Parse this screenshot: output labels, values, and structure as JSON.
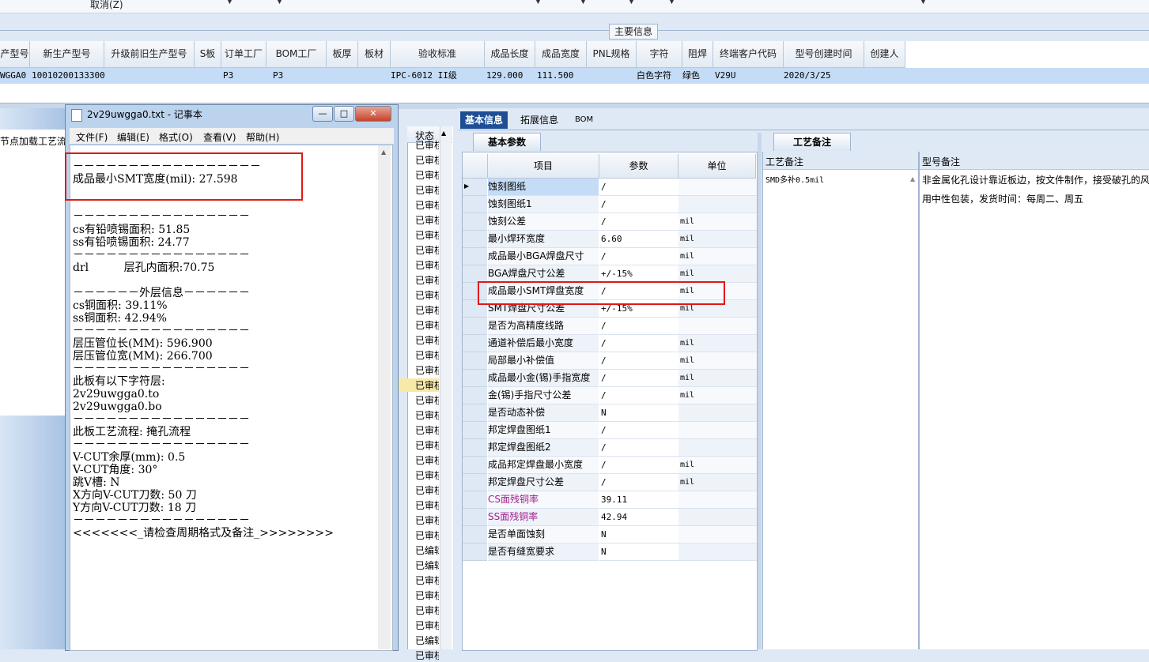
{
  "toolbar": {
    "cancel_label": "取消(Z)"
  },
  "main_info_label": "主要信息",
  "grid": {
    "headers": [
      "产型号",
      "新生产型号",
      "升级前旧生产型号",
      "S板",
      "订单工厂",
      "BOM工厂",
      "板厚",
      "板材",
      "验收标准",
      "成品长度",
      "成品宽度",
      "PNL规格",
      "字符",
      "阻焊",
      "终端客户代码",
      "型号创建时间",
      "创建人"
    ],
    "row": [
      "WGGA0",
      "10010200133300",
      "",
      "",
      "P3",
      "P3",
      "",
      "",
      "IPC-6012 II级",
      "129.000",
      "111.500",
      "",
      "白色字符",
      "绿色",
      "V29U",
      "2020/3/25",
      ""
    ]
  },
  "left_label": "节点加载工艺流",
  "notepad": {
    "title": "2v29uwgga0.txt - 记事本",
    "menu": [
      "文件(F)",
      "编辑(E)",
      "格式(O)",
      "查看(V)",
      "帮助(H)"
    ],
    "buttons": {
      "min": "—",
      "max": "□",
      "close": "✕"
    },
    "lines": [
      "－－－－－－－－－－－－－－－－－",
      "成品最小SMT宽度(mil): 27.598",
      "－－－－－－－－－－－－－－－－",
      "cs有铅喷锡面积: 51.85",
      "ss有铅喷锡面积: 24.77",
      "－－－－－－－－－－－－－－－－",
      "drl          层孔内面积:70.75",
      "－－－－－－外层信息－－－－－－",
      "cs铜面积: 39.11%",
      "ss铜面积: 42.94%",
      "－－－－－－－－－－－－－－－－",
      "层压管位长(MM): 596.900",
      "层压管位宽(MM): 266.700",
      "－－－－－－－－－－－－－－－－",
      "此板有以下字符层:",
      "2v29uwgga0.to",
      "2v29uwgga0.bo",
      "－－－－－－－－－－－－－－－－",
      "此板工艺流程: 掩孔流程",
      "－－－－－－－－－－－－－－－－",
      "V-CUT余厚(mm): 0.5",
      "V-CUT角度: 30°",
      "跳V槽: N",
      "X方向V-CUT刀数: 50 刀",
      "Y方向V-CUT刀数: 18 刀",
      "－－－－－－－－－－－－－－－－",
      "<<<<<<<_请检查周期格式及备注_>>>>>>>>"
    ]
  },
  "status": {
    "header": "状态",
    "items": [
      "已审核",
      "已审核",
      "已审核",
      "已审核",
      "已审核",
      "已审核",
      "已审核",
      "已审核",
      "已审核",
      "已审核",
      "已审核",
      "已审核",
      "已审核",
      "已审核",
      "已审核",
      "已审核",
      "已审核",
      "已审核",
      "已审核",
      "已审核",
      "已审核",
      "已审核",
      "已审核",
      "已审核",
      "已审核",
      "已审核",
      "已审核",
      "已编辑",
      "已编辑",
      "已审核",
      "已审核",
      "已审核",
      "已审核",
      "已编辑",
      "已审核"
    ]
  },
  "tabs": [
    "基本信息",
    "拓展信息",
    "BOM"
  ],
  "basic_params": {
    "subtab": "基本参数",
    "headers": [
      "项目",
      "参数",
      "单位"
    ],
    "rows": [
      {
        "item": "蚀刻图纸",
        "param": "/",
        "unit": ""
      },
      {
        "item": "蚀刻图纸1",
        "param": "/",
        "unit": ""
      },
      {
        "item": "蚀刻公差",
        "param": "/",
        "unit": "mil"
      },
      {
        "item": "最小焊环宽度",
        "param": "6.60",
        "unit": "mil"
      },
      {
        "item": "成品最小BGA焊盘尺寸",
        "param": "/",
        "unit": "mil"
      },
      {
        "item": "BGA焊盘尺寸公差",
        "param": "+/-15%",
        "unit": "mil"
      },
      {
        "item": "成品最小SMT焊盘宽度",
        "param": "/",
        "unit": "mil"
      },
      {
        "item": "SMT焊盘尺寸公差",
        "param": "+/-15%",
        "unit": "mil"
      },
      {
        "item": "是否为高精度线路",
        "param": "/",
        "unit": ""
      },
      {
        "item": "通道补偿后最小宽度",
        "param": "/",
        "unit": "mil"
      },
      {
        "item": "局部最小补偿值",
        "param": "/",
        "unit": "mil"
      },
      {
        "item": "成品最小金(锡)手指宽度",
        "param": "/",
        "unit": "mil"
      },
      {
        "item": "金(锡)手指尺寸公差",
        "param": "/",
        "unit": "mil"
      },
      {
        "item": "是否动态补偿",
        "param": "N",
        "unit": ""
      },
      {
        "item": "邦定焊盘图纸1",
        "param": "/",
        "unit": ""
      },
      {
        "item": "邦定焊盘图纸2",
        "param": "/",
        "unit": ""
      },
      {
        "item": "成品邦定焊盘最小宽度",
        "param": "/",
        "unit": "mil"
      },
      {
        "item": "邦定焊盘尺寸公差",
        "param": "/",
        "unit": "mil"
      },
      {
        "item": "CS面残铜率",
        "param": "39.11",
        "unit": ""
      },
      {
        "item": "SS面残铜率",
        "param": "42.94",
        "unit": ""
      },
      {
        "item": "是否单面蚀刻",
        "param": "N",
        "unit": ""
      },
      {
        "item": "是否有缝宽要求",
        "param": "N",
        "unit": ""
      }
    ],
    "highlight_color": "#a0208a"
  },
  "craft_notes": {
    "tab": "工艺备注",
    "col1_header": "工艺备注",
    "col2_header": "型号备注",
    "col1_text": "SMD多补0.5mil",
    "col2_line1": "非金属化孔设计靠近板边，按文件制作，接受破孔的风",
    "col2_line2": "用中性包装，发货时间：每周二、周五"
  }
}
